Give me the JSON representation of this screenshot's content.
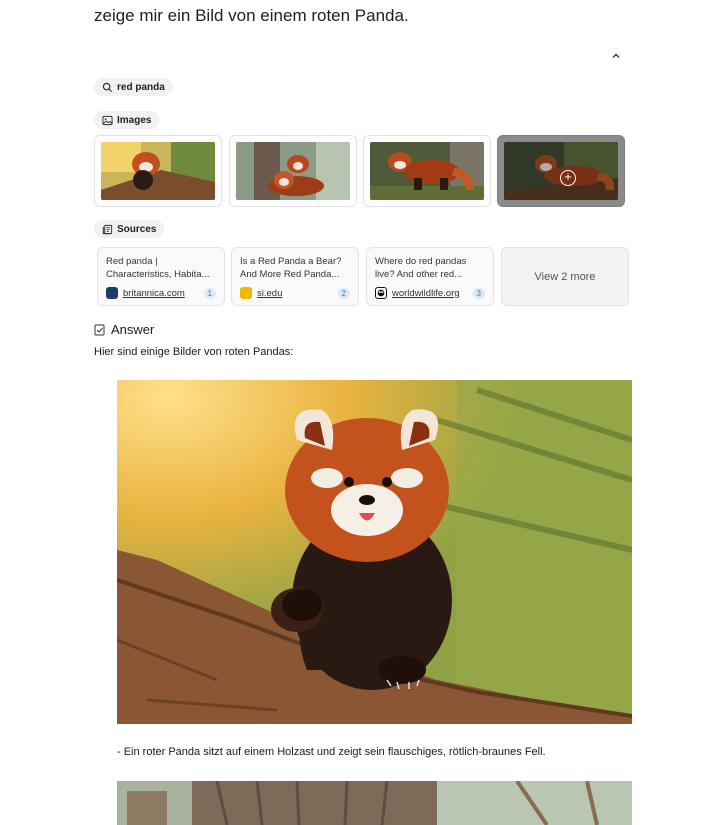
{
  "query": "zeige mir ein Bild von einem roten Panda.",
  "search_chip": {
    "label": "red panda"
  },
  "images_section": {
    "label": "Images",
    "thumb_names": [
      "red-panda-thumb-1",
      "red-panda-thumb-2",
      "red-panda-thumb-3",
      "red-panda-thumb-4"
    ]
  },
  "sources_section": {
    "label": "Sources",
    "items": [
      {
        "title": "Red panda | Characteristics, Habita...",
        "domain": "britannica.com",
        "index": "1",
        "favicon_color": "#1e3d6b"
      },
      {
        "title": "Is a Red Panda a Bear? And More Red Panda...",
        "domain": "si.edu",
        "index": "2",
        "favicon_color": "#f2b705"
      },
      {
        "title": "Where do red pandas live? And other red...",
        "domain": "worldwildlife.org",
        "index": "3",
        "favicon_color": "#111111"
      }
    ],
    "more_label": "View 2 more"
  },
  "answer": {
    "heading": "Answer",
    "intro": "Hier sind einige Bilder von roten Pandas:",
    "caption_1": "- Ein roter Panda sitzt auf einem Holzast und zeigt sein flauschiges, rötlich-braunes Fell."
  }
}
